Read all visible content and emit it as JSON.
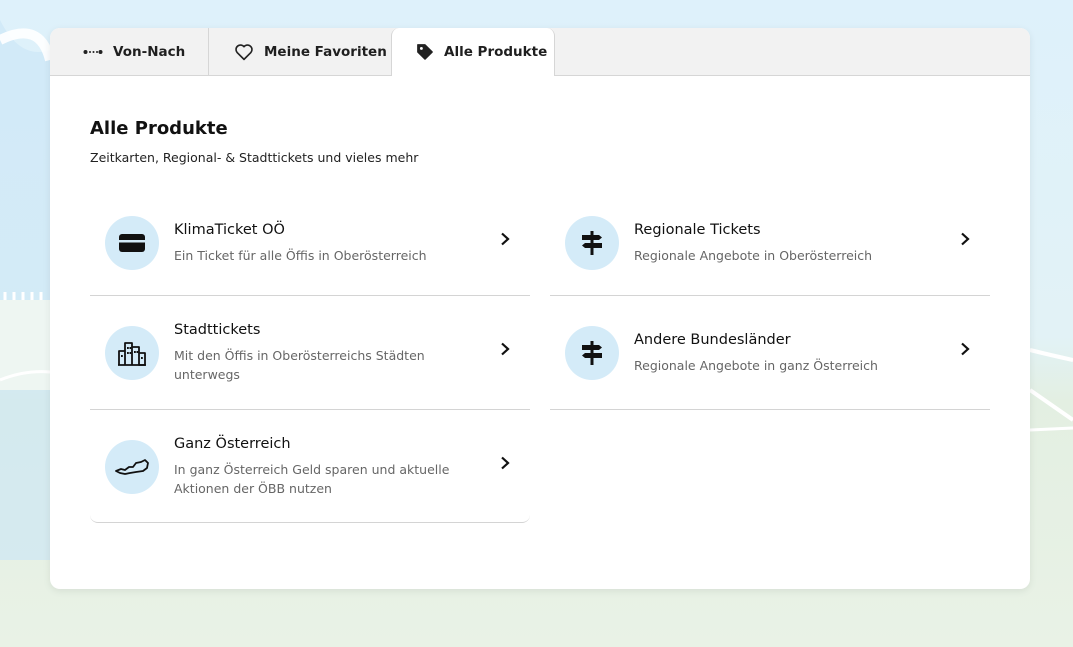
{
  "tabs": [
    {
      "label": "Von-Nach",
      "icon": "route-dots-icon",
      "active": false
    },
    {
      "label": "Meine Favoriten",
      "icon": "heart-icon",
      "active": false
    },
    {
      "label": "Alle Produkte",
      "icon": "tag-icon",
      "active": true
    }
  ],
  "main": {
    "title": "Alle Produkte",
    "subtitle": "Zeitkarten, Regional- & Stadttickets und vieles mehr"
  },
  "products": [
    {
      "title": "KlimaTicket OÖ",
      "description": "Ein Ticket für alle Öffis in Oberösterreich",
      "icon": "credit-card-icon"
    },
    {
      "title": "Regionale Tickets",
      "description": "Regionale Angebote in Oberösterreich",
      "icon": "signpost-icon"
    },
    {
      "title": "Stadttickets",
      "description": "Mit den Öffis in Oberösterreichs Städten unterwegs",
      "icon": "city-buildings-icon"
    },
    {
      "title": "Andere Bundesländer",
      "description": "Regionale Angebote in ganz Österreich",
      "icon": "signpost-icon"
    },
    {
      "title": "Ganz Österreich",
      "description": "In ganz Österreich Geld sparen und aktuelle Aktionen der ÖBB nutzen",
      "icon": "austria-map-icon"
    }
  ],
  "colors": {
    "icon_circle": "#d4ebf8",
    "background_sky": "#def1fb",
    "background_ground": "#e3efe2",
    "card": "#ffffff"
  }
}
